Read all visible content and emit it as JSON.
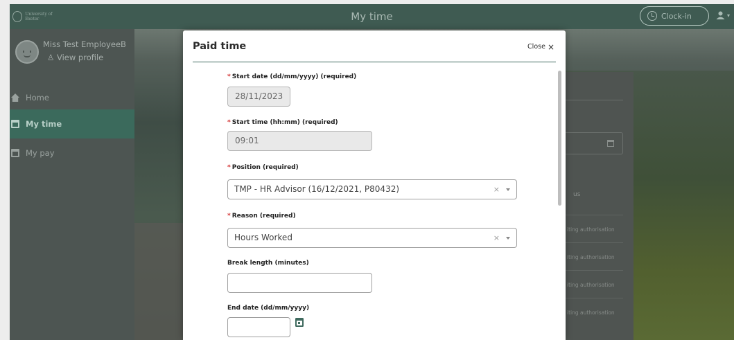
{
  "topbar": {
    "logo_text": "University of Exeter",
    "title": "My time",
    "clockin_label": "Clock-in",
    "user_menu_caret": "▾"
  },
  "sidebar": {
    "user_name": "Miss Test EmployeeB",
    "view_profile": "View profile",
    "items": [
      {
        "label": "Home",
        "icon": "home-icon",
        "active": false
      },
      {
        "label": "My time",
        "icon": "calendar-icon",
        "active": true
      },
      {
        "label": "My pay",
        "icon": "card-icon",
        "active": false
      }
    ]
  },
  "background_page": {
    "status_header": "us",
    "rows": [
      "iting authorisation",
      "iting authorisation",
      "iting authorisation",
      "iting authorisation"
    ]
  },
  "modal": {
    "title": "Paid time",
    "close_label": "Close",
    "close_icon": "×",
    "fields": {
      "start_date": {
        "label": "Start date (dd/mm/yyyy) (required)",
        "value": "28/11/2023",
        "required": true,
        "disabled": true
      },
      "start_time": {
        "label": "Start time (hh:mm) (required)",
        "value": "09:01",
        "required": true,
        "disabled": true
      },
      "position": {
        "label": "Position  (required)",
        "value": "TMP - HR Advisor (16/12/2021, P80432)",
        "required": true,
        "clear": "×"
      },
      "reason": {
        "label": "Reason  (required)",
        "value": "Hours Worked",
        "required": true,
        "clear": "×"
      },
      "break_length": {
        "label": "Break length (minutes)",
        "value": ""
      },
      "end_date": {
        "label": "End date (dd/mm/yyyy)",
        "value": ""
      }
    },
    "required_marker": "*"
  },
  "colors": {
    "brand": "#3f6a5e",
    "required": "#d32f2f"
  }
}
